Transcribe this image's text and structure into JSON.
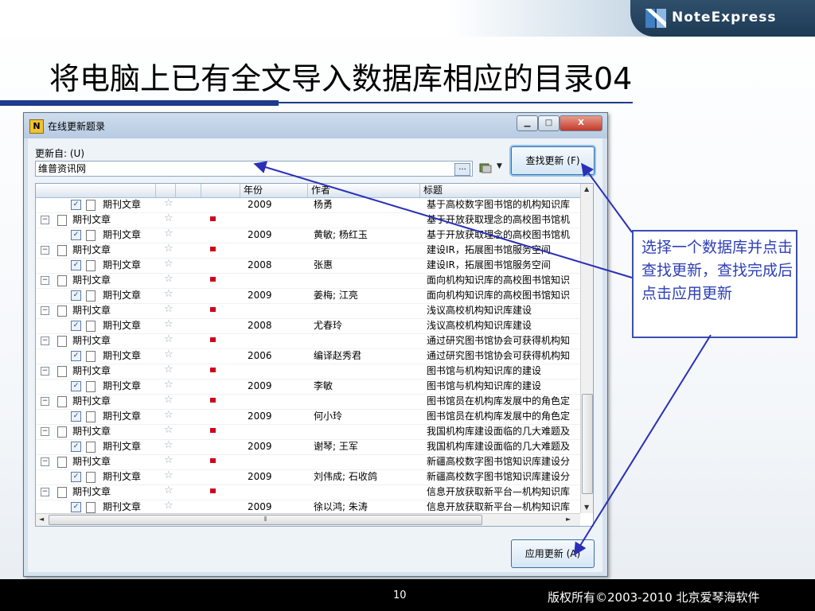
{
  "slide": {
    "title": "将电脑上已有全文导入数据库相应的目录04",
    "logo_text": "NoteExpress",
    "page_number": "10",
    "copyright": "版权所有©2003-2010 北京爱琴海软件"
  },
  "window": {
    "title": "在线更新题录",
    "app_icon_letter": "N",
    "controls": {
      "minimize": "▁",
      "maximize": "□",
      "close": "X"
    }
  },
  "form": {
    "update_from_label": "更新自: (U)",
    "source_value": "维普资讯网",
    "browse_label": "...",
    "find_update_button": "查找更新 (F)",
    "apply_update_button": "应用更新 (A)"
  },
  "grid": {
    "columns": [
      "年份",
      "作者",
      "标题"
    ],
    "rows": [
      {
        "type": "child",
        "category": "期刊文章",
        "year": "2009",
        "author": "杨勇",
        "title": "基于高校数字图书馆的机构知识库"
      },
      {
        "type": "group",
        "category": "期刊文章",
        "year": "",
        "author": "",
        "title": "基于开放获取理念的高校图书馆机"
      },
      {
        "type": "child",
        "category": "期刊文章",
        "year": "2009",
        "author": "黄敏; 杨红玉",
        "title": "基于开放获取理念的高校图书馆机"
      },
      {
        "type": "group",
        "category": "期刊文章",
        "year": "",
        "author": "",
        "title": "建设IR，拓展图书馆服务空间"
      },
      {
        "type": "child",
        "category": "期刊文章",
        "year": "2008",
        "author": "张惠",
        "title": "建设IR，拓展图书馆服务空间"
      },
      {
        "type": "group",
        "category": "期刊文章",
        "year": "",
        "author": "",
        "title": "面向机构知识库的高校图书馆知识"
      },
      {
        "type": "child",
        "category": "期刊文章",
        "year": "2009",
        "author": "姜梅; 江亮",
        "title": "面向机构知识库的高校图书馆知识"
      },
      {
        "type": "group",
        "category": "期刊文章",
        "year": "",
        "author": "",
        "title": "浅议高校机构知识库建设"
      },
      {
        "type": "child",
        "category": "期刊文章",
        "year": "2008",
        "author": "尤春玲",
        "title": "浅议高校机构知识库建设"
      },
      {
        "type": "group",
        "category": "期刊文章",
        "year": "",
        "author": "",
        "title": "通过研究图书馆协会可获得机构知"
      },
      {
        "type": "child",
        "category": "期刊文章",
        "year": "2006",
        "author": "编译赵秀君",
        "title": "通过研究图书馆协会可获得机构知"
      },
      {
        "type": "group",
        "category": "期刊文章",
        "year": "",
        "author": "",
        "title": "图书馆与机构知识库的建设"
      },
      {
        "type": "child",
        "category": "期刊文章",
        "year": "2009",
        "author": "李敏",
        "title": "图书馆与机构知识库的建设"
      },
      {
        "type": "group",
        "category": "期刊文章",
        "year": "",
        "author": "",
        "title": "图书馆员在机构库发展中的角色定"
      },
      {
        "type": "child",
        "category": "期刊文章",
        "year": "2009",
        "author": "何小玲",
        "title": "图书馆员在机构库发展中的角色定"
      },
      {
        "type": "group",
        "category": "期刊文章",
        "year": "",
        "author": "",
        "title": "我国机构库建设面临的几大难题及"
      },
      {
        "type": "child",
        "category": "期刊文章",
        "year": "2009",
        "author": "谢琴; 王军",
        "title": "我国机构库建设面临的几大难题及"
      },
      {
        "type": "group",
        "category": "期刊文章",
        "year": "",
        "author": "",
        "title": "新疆高校数字图书馆知识库建设分"
      },
      {
        "type": "child",
        "category": "期刊文章",
        "year": "2009",
        "author": "刘伟成; 石收鸽",
        "title": "新疆高校数字图书馆知识库建设分"
      },
      {
        "type": "group",
        "category": "期刊文章",
        "year": "",
        "author": "",
        "title": "信息开放获取新平台—机构知识库"
      },
      {
        "type": "child",
        "category": "期刊文章",
        "year": "2009",
        "author": "徐以鸿; 朱涛",
        "title": "信息开放获取新平台—机构知识库"
      }
    ]
  },
  "callout": {
    "text": "选择一个数据库并点击查找更新，查找完成后点击应用更新"
  },
  "colors": {
    "accent": "#1e3a8a",
    "callout": "#3a4fb0",
    "flag": "#d0021b"
  },
  "icons": [
    "notexpress-logo-icon",
    "app-icon",
    "expand-icon",
    "checkbox-icon",
    "document-icon",
    "star-icon",
    "flag-icon",
    "database-icon"
  ]
}
